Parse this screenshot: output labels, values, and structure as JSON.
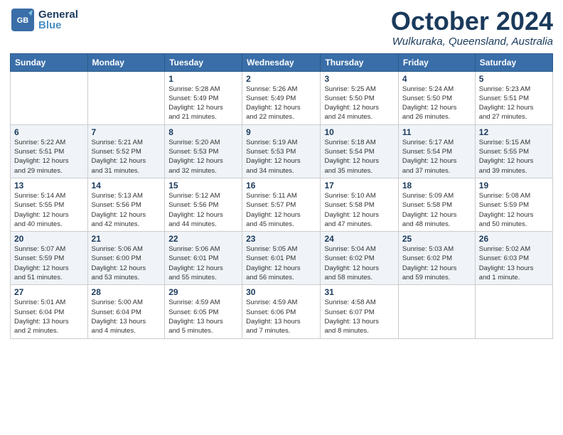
{
  "header": {
    "logo": {
      "general": "General",
      "blue": "Blue"
    },
    "title": "October 2024",
    "location": "Wulkuraka, Queensland, Australia"
  },
  "columns": [
    "Sunday",
    "Monday",
    "Tuesday",
    "Wednesday",
    "Thursday",
    "Friday",
    "Saturday"
  ],
  "weeks": [
    [
      {
        "day": "",
        "info": ""
      },
      {
        "day": "",
        "info": ""
      },
      {
        "day": "1",
        "info": "Sunrise: 5:28 AM\nSunset: 5:49 PM\nDaylight: 12 hours\nand 21 minutes."
      },
      {
        "day": "2",
        "info": "Sunrise: 5:26 AM\nSunset: 5:49 PM\nDaylight: 12 hours\nand 22 minutes."
      },
      {
        "day": "3",
        "info": "Sunrise: 5:25 AM\nSunset: 5:50 PM\nDaylight: 12 hours\nand 24 minutes."
      },
      {
        "day": "4",
        "info": "Sunrise: 5:24 AM\nSunset: 5:50 PM\nDaylight: 12 hours\nand 26 minutes."
      },
      {
        "day": "5",
        "info": "Sunrise: 5:23 AM\nSunset: 5:51 PM\nDaylight: 12 hours\nand 27 minutes."
      }
    ],
    [
      {
        "day": "6",
        "info": "Sunrise: 5:22 AM\nSunset: 5:51 PM\nDaylight: 12 hours\nand 29 minutes."
      },
      {
        "day": "7",
        "info": "Sunrise: 5:21 AM\nSunset: 5:52 PM\nDaylight: 12 hours\nand 31 minutes."
      },
      {
        "day": "8",
        "info": "Sunrise: 5:20 AM\nSunset: 5:53 PM\nDaylight: 12 hours\nand 32 minutes."
      },
      {
        "day": "9",
        "info": "Sunrise: 5:19 AM\nSunset: 5:53 PM\nDaylight: 12 hours\nand 34 minutes."
      },
      {
        "day": "10",
        "info": "Sunrise: 5:18 AM\nSunset: 5:54 PM\nDaylight: 12 hours\nand 35 minutes."
      },
      {
        "day": "11",
        "info": "Sunrise: 5:17 AM\nSunset: 5:54 PM\nDaylight: 12 hours\nand 37 minutes."
      },
      {
        "day": "12",
        "info": "Sunrise: 5:15 AM\nSunset: 5:55 PM\nDaylight: 12 hours\nand 39 minutes."
      }
    ],
    [
      {
        "day": "13",
        "info": "Sunrise: 5:14 AM\nSunset: 5:55 PM\nDaylight: 12 hours\nand 40 minutes."
      },
      {
        "day": "14",
        "info": "Sunrise: 5:13 AM\nSunset: 5:56 PM\nDaylight: 12 hours\nand 42 minutes."
      },
      {
        "day": "15",
        "info": "Sunrise: 5:12 AM\nSunset: 5:56 PM\nDaylight: 12 hours\nand 44 minutes."
      },
      {
        "day": "16",
        "info": "Sunrise: 5:11 AM\nSunset: 5:57 PM\nDaylight: 12 hours\nand 45 minutes."
      },
      {
        "day": "17",
        "info": "Sunrise: 5:10 AM\nSunset: 5:58 PM\nDaylight: 12 hours\nand 47 minutes."
      },
      {
        "day": "18",
        "info": "Sunrise: 5:09 AM\nSunset: 5:58 PM\nDaylight: 12 hours\nand 48 minutes."
      },
      {
        "day": "19",
        "info": "Sunrise: 5:08 AM\nSunset: 5:59 PM\nDaylight: 12 hours\nand 50 minutes."
      }
    ],
    [
      {
        "day": "20",
        "info": "Sunrise: 5:07 AM\nSunset: 5:59 PM\nDaylight: 12 hours\nand 51 minutes."
      },
      {
        "day": "21",
        "info": "Sunrise: 5:06 AM\nSunset: 6:00 PM\nDaylight: 12 hours\nand 53 minutes."
      },
      {
        "day": "22",
        "info": "Sunrise: 5:06 AM\nSunset: 6:01 PM\nDaylight: 12 hours\nand 55 minutes."
      },
      {
        "day": "23",
        "info": "Sunrise: 5:05 AM\nSunset: 6:01 PM\nDaylight: 12 hours\nand 56 minutes."
      },
      {
        "day": "24",
        "info": "Sunrise: 5:04 AM\nSunset: 6:02 PM\nDaylight: 12 hours\nand 58 minutes."
      },
      {
        "day": "25",
        "info": "Sunrise: 5:03 AM\nSunset: 6:02 PM\nDaylight: 12 hours\nand 59 minutes."
      },
      {
        "day": "26",
        "info": "Sunrise: 5:02 AM\nSunset: 6:03 PM\nDaylight: 13 hours\nand 1 minute."
      }
    ],
    [
      {
        "day": "27",
        "info": "Sunrise: 5:01 AM\nSunset: 6:04 PM\nDaylight: 13 hours\nand 2 minutes."
      },
      {
        "day": "28",
        "info": "Sunrise: 5:00 AM\nSunset: 6:04 PM\nDaylight: 13 hours\nand 4 minutes."
      },
      {
        "day": "29",
        "info": "Sunrise: 4:59 AM\nSunset: 6:05 PM\nDaylight: 13 hours\nand 5 minutes."
      },
      {
        "day": "30",
        "info": "Sunrise: 4:59 AM\nSunset: 6:06 PM\nDaylight: 13 hours\nand 7 minutes."
      },
      {
        "day": "31",
        "info": "Sunrise: 4:58 AM\nSunset: 6:07 PM\nDaylight: 13 hours\nand 8 minutes."
      },
      {
        "day": "",
        "info": ""
      },
      {
        "day": "",
        "info": ""
      }
    ]
  ]
}
